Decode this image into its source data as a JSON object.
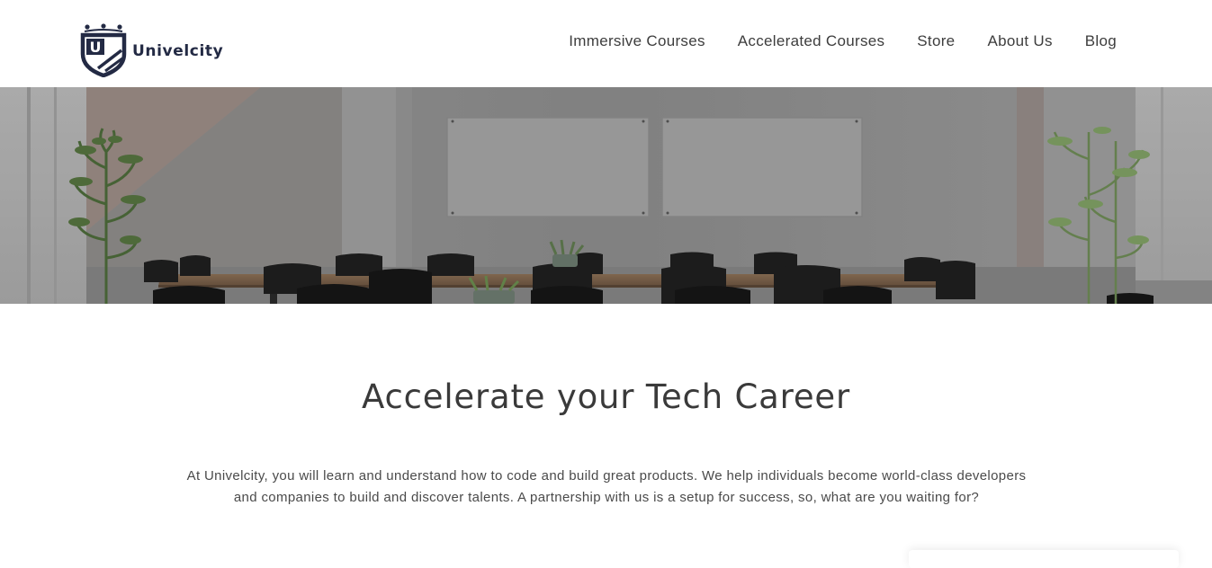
{
  "brand": {
    "name": "Univelcity",
    "logo_letter": "U",
    "color": "#232a44"
  },
  "nav": {
    "items": [
      {
        "label": "Immersive Courses"
      },
      {
        "label": "Accelerated Courses"
      },
      {
        "label": "Store"
      },
      {
        "label": "About Us"
      },
      {
        "label": "Blog"
      }
    ]
  },
  "hero": {
    "image": "office-meeting-room-photo"
  },
  "main": {
    "headline": "Accelerate your Tech Career",
    "intro": "At Univelcity, you will learn and understand how to code and build great products. We help individuals become world-class developers and companies to build and discover talents. A partnership with us is a setup for success, so, what are you waiting for?"
  },
  "colors": {
    "text": "#3a3a3a",
    "brand": "#232a44",
    "background": "#ffffff"
  }
}
